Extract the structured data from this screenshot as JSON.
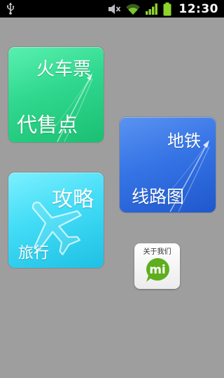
{
  "status_bar": {
    "time": "12:30",
    "icons": [
      "usb-icon",
      "mute-icon",
      "wifi-icon",
      "signal-icon",
      "battery-icon"
    ]
  },
  "tiles": {
    "train": {
      "title": "火车票",
      "subtitle": "代售点",
      "color": "#2fd88e"
    },
    "metro": {
      "title": "地铁",
      "subtitle": "线路图",
      "color": "#3674e6"
    },
    "travel": {
      "title": "攻略",
      "subtitle": "旅行",
      "color": "#42dcf6"
    },
    "about": {
      "label": "关于我们",
      "logo": "mi-logo-icon",
      "color": "#5fae1e"
    }
  }
}
